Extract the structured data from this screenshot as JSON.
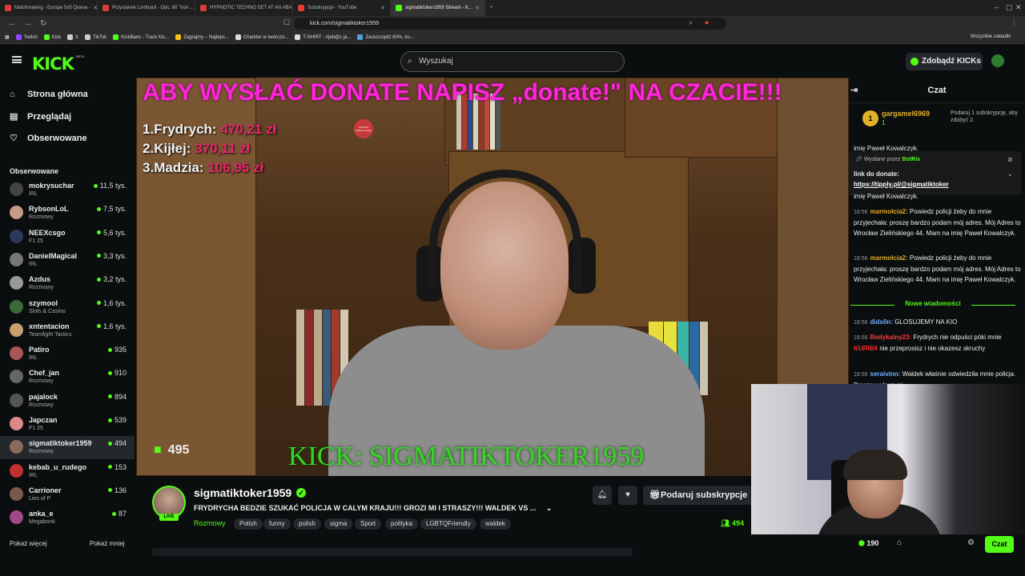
{
  "browser": {
    "tabs": [
      {
        "title": "Matchmaking - Europe 5v5 Queue -",
        "color": "#e03a3a"
      },
      {
        "title": "Przystanek Lombard - Odc. 80 \"Iron ...",
        "color": "#e03a3a"
      },
      {
        "title": "HYPNOTIC TECHNO SET AT AN ABAN...",
        "color": "#e03a3a"
      },
      {
        "title": "Subskrypcje - YouTube",
        "color": "#e03a3a"
      },
      {
        "title": "sigmatiktoker1959 Stream - K...",
        "color": "#53fc18",
        "active": true
      }
    ],
    "new_tab": "+",
    "url": "kick.com/sigmatiktoker1959",
    "bookmarks": [
      "Twitch",
      "Kick",
      "X",
      "TikTok",
      "KickBans - Track Kic...",
      "Zagrajmy – Najleps...",
      "Charkter w twórczo...",
      "T-SHIRT - #jeb@c ja...",
      "Zaoszczędź 60%, ku..."
    ],
    "bookmarks_all": "Wszystkie zakładki"
  },
  "header": {
    "logo": "KICK",
    "beta": "BETA",
    "search_placeholder": "Wyszukaj",
    "get_kicks": "Zdobądź KICKs",
    "brand_color": "#53fc18"
  },
  "sidebar": {
    "nav": [
      {
        "label": "Strona główna",
        "icon": "home-icon"
      },
      {
        "label": "Przeglądaj",
        "icon": "browse-icon"
      },
      {
        "label": "Obserwowane",
        "icon": "heart-icon"
      }
    ],
    "following_header": "Obserwowane",
    "following": [
      {
        "name": "mokrysuchar",
        "category": "IRL",
        "viewers": "11,5 tys.",
        "color": "#444"
      },
      {
        "name": "RybsonLoL",
        "category": "Rozmowy",
        "viewers": "7,5 tys.",
        "color": "#c79a8a"
      },
      {
        "name": "NEEXcsgo",
        "category": "F1 25",
        "viewers": "5,6 tys.",
        "color": "#2a3a5a"
      },
      {
        "name": "DanielMagical",
        "category": "IRL",
        "viewers": "3,3 tys.",
        "color": "#777"
      },
      {
        "name": "Azdus",
        "category": "Rozmowy",
        "viewers": "3,2 tys.",
        "color": "#999"
      },
      {
        "name": "szymool",
        "category": "Slots & Casino",
        "viewers": "1,6 tys.",
        "color": "#3a6a3a"
      },
      {
        "name": "xntentacion",
        "category": "Teamfight Tactics",
        "viewers": "1,6 tys.",
        "color": "#c8a070"
      },
      {
        "name": "Patiro",
        "category": "IRL",
        "viewers": "935",
        "color": "#aa5555"
      },
      {
        "name": "Chef_jan",
        "category": "Rozmowy",
        "viewers": "910",
        "color": "#666"
      },
      {
        "name": "pajalock",
        "category": "Rozmowy",
        "viewers": "894",
        "color": "#555"
      },
      {
        "name": "Japczan",
        "category": "F1 25",
        "viewers": "539",
        "color": "#d88"
      },
      {
        "name": "sigmatiktoker1959",
        "category": "Rozmowy",
        "viewers": "494",
        "color": "#8a6a5a",
        "selected": true
      },
      {
        "name": "kebab_u_rudego",
        "category": "IRL",
        "viewers": "153",
        "color": "#c03030"
      },
      {
        "name": "Carrioner",
        "category": "Lies of P",
        "viewers": "136",
        "color": "#7a5a4a"
      },
      {
        "name": "anka_e",
        "category": "Megabonk",
        "viewers": "87",
        "color": "#a04a8a"
      }
    ],
    "show_more": "Pokaż więcej",
    "show_less": "Pokaż mniej"
  },
  "video": {
    "overlay_title": "ABY WYSŁAĆ DONATE NAPISZ „donate!\" NA CZACIE!!!",
    "donors": [
      {
        "rank": "1.",
        "name": "Frydrych:",
        "amount": "470,21 zł"
      },
      {
        "rank": "2.",
        "name": "Kijłej:",
        "amount": "370,11 zł"
      },
      {
        "rank": "3.",
        "name": "Madzia:",
        "amount": "106,95 zł"
      }
    ],
    "watermark": "KICK: SIGMATIKTOKER1959",
    "viewer_count": "495",
    "sticker": "wiedźmin szalenie zgrany"
  },
  "channel": {
    "name": "sigmatiktoker1959",
    "live": "LIVE",
    "title": "FRYDRYCHA BEDZIE SZUKAĆ POLICJA W CALYM KRAJU!!! GROZI MI I STRASZY!!! WALDEK VS ...",
    "category": "Rozmowy",
    "tags": [
      "Polish",
      "funny",
      "polish",
      "sigma",
      "Sport",
      "polityka",
      "LGBTQFriendly",
      "waldek"
    ],
    "subscribe_label": "Podaruj subskrypcje",
    "viewers": "494"
  },
  "chat": {
    "title": "Czat",
    "gift": {
      "user": "gargamel6969",
      "count": "1",
      "desc": "Podaruj 1 subskrypcję, aby zdobyć 2."
    },
    "partial_line": "imię Paweł Kowalczyk.",
    "pinned": {
      "sent_by": "Wysłane przez",
      "bot": "BotRix",
      "text": "link do donate:",
      "link": "https://tipply.pl/@sigmatiktoker"
    },
    "partial_line2": "imię Paweł Kowalczyk.",
    "messages": [
      {
        "time": "18:56",
        "user": "marmolcia2:",
        "text": "Powiedz policji żeby do mnie przyjechała: proszę bardzo podam mój adres. Mój Adres to Wrocław Zielińskiego 44. Mam na imię Paweł Kowalczyk."
      },
      {
        "time": "18:56",
        "user": "marmolcia2:",
        "text": "Powiedz policji żeby do mnie przyjechała: proszę bardzo podam mój adres. Mój Adres to Wrocław Zielińskiego 44. Mam na imię Paweł Kowalczyk."
      }
    ],
    "new_messages": "Nowe wiadomości",
    "messages2": [
      {
        "time": "18:56",
        "user": "dids0n:",
        "text": "GLOSUJEMY NA KIO"
      },
      {
        "time": "18:56",
        "user": "Redykalny23:",
        "text": "Frydrych nie odpuści póki mnie",
        "emote": "KURWA",
        "text2": "nie przeprosisz i nie okazesz skruchy"
      },
      {
        "time": "18:56",
        "user": "seraivinn:",
        "text": "Waldek właśnie odwiedziła mnie policja. Proszę wyłącz mi..."
      }
    ],
    "points": "190",
    "send_label": "Czat"
  }
}
